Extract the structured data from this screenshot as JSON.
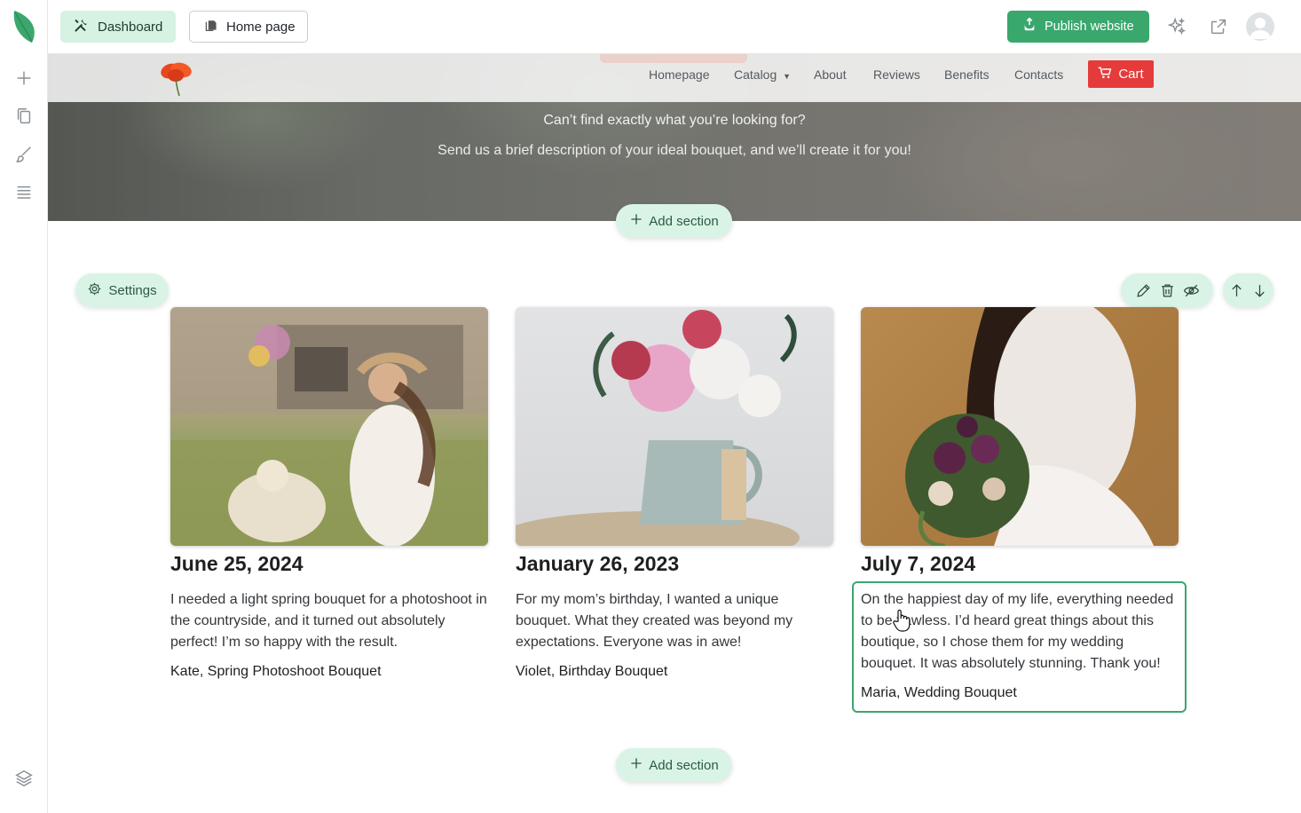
{
  "topbar": {
    "dashboard_label": "Dashboard",
    "home_page_label": "Home page",
    "publish_label": "Publish website"
  },
  "site_nav": {
    "links": [
      "Homepage",
      "Catalog",
      "About",
      "Reviews",
      "Benefits",
      "Contacts"
    ],
    "cart_label": "Cart"
  },
  "hero": {
    "line1": "Can’t find exactly what you’re looking for?",
    "line2": "Send us a brief description of your ideal bouquet, and we’ll create it for you!"
  },
  "editor": {
    "add_section_label": "Add section",
    "settings_label": "Settings"
  },
  "reviews": [
    {
      "date": "June 25, 2024",
      "text": "I needed a light spring bouquet for a photoshoot in the countryside, and it turned out absolutely perfect! I’m so happy with the result.",
      "author": "Kate, Spring Photoshoot Bouquet"
    },
    {
      "date": "January 26, 2023",
      "text": "For my mom’s birthday, I wanted a unique bouquet. What they created was beyond my expectations. Everyone was in awe!",
      "author": "Violet, Birthday Bouquet"
    },
    {
      "date": "July 7, 2024",
      "text": "On the happiest day of my life, everything needed to be flawless. I’d heard great things about this boutique, so I chose them for my wedding bouquet. It was absolutely stunning. Thank you!",
      "author": "Maria, Wedding Bouquet"
    }
  ],
  "colors": {
    "accent_green": "#3aa76d",
    "pill_green": "#d9f4e6",
    "cart_red": "#e53b3b"
  },
  "icons": [
    "leaf-logo-icon",
    "plus-icon",
    "pages-icon",
    "brush-icon",
    "sections-icon",
    "layers-icon",
    "tools-icon",
    "page-icon",
    "publish-icon",
    "sparkle-icon",
    "external-link-icon",
    "user-avatar-icon",
    "poppy-logo-icon",
    "cart-icon",
    "gear-icon",
    "pencil-icon",
    "trash-icon",
    "eye-off-icon",
    "arrow-up-icon",
    "arrow-down-icon",
    "hand-cursor-icon"
  ]
}
